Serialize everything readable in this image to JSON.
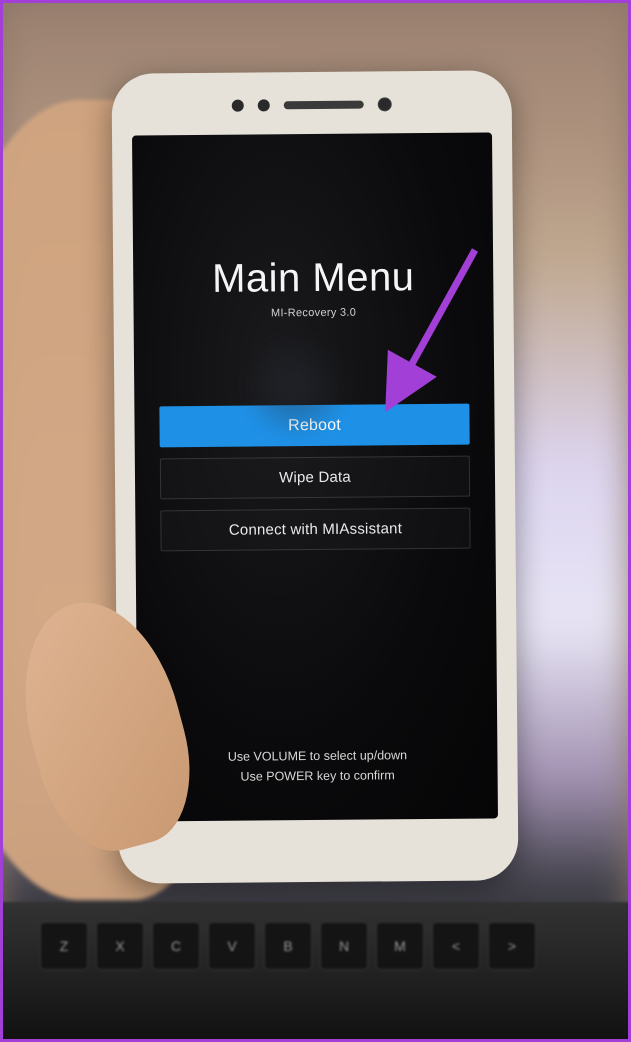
{
  "recovery": {
    "title": "Main Menu",
    "subtitle": "MI-Recovery 3.0",
    "menu_items": [
      {
        "label": "Reboot",
        "selected": true
      },
      {
        "label": "Wipe Data",
        "selected": false
      },
      {
        "label": "Connect with MIAssistant",
        "selected": false
      }
    ],
    "instruction_line1": "Use VOLUME to select up/down",
    "instruction_line2": "Use POWER key to confirm"
  },
  "annotation": {
    "arrow_color": "#a23fd6"
  }
}
